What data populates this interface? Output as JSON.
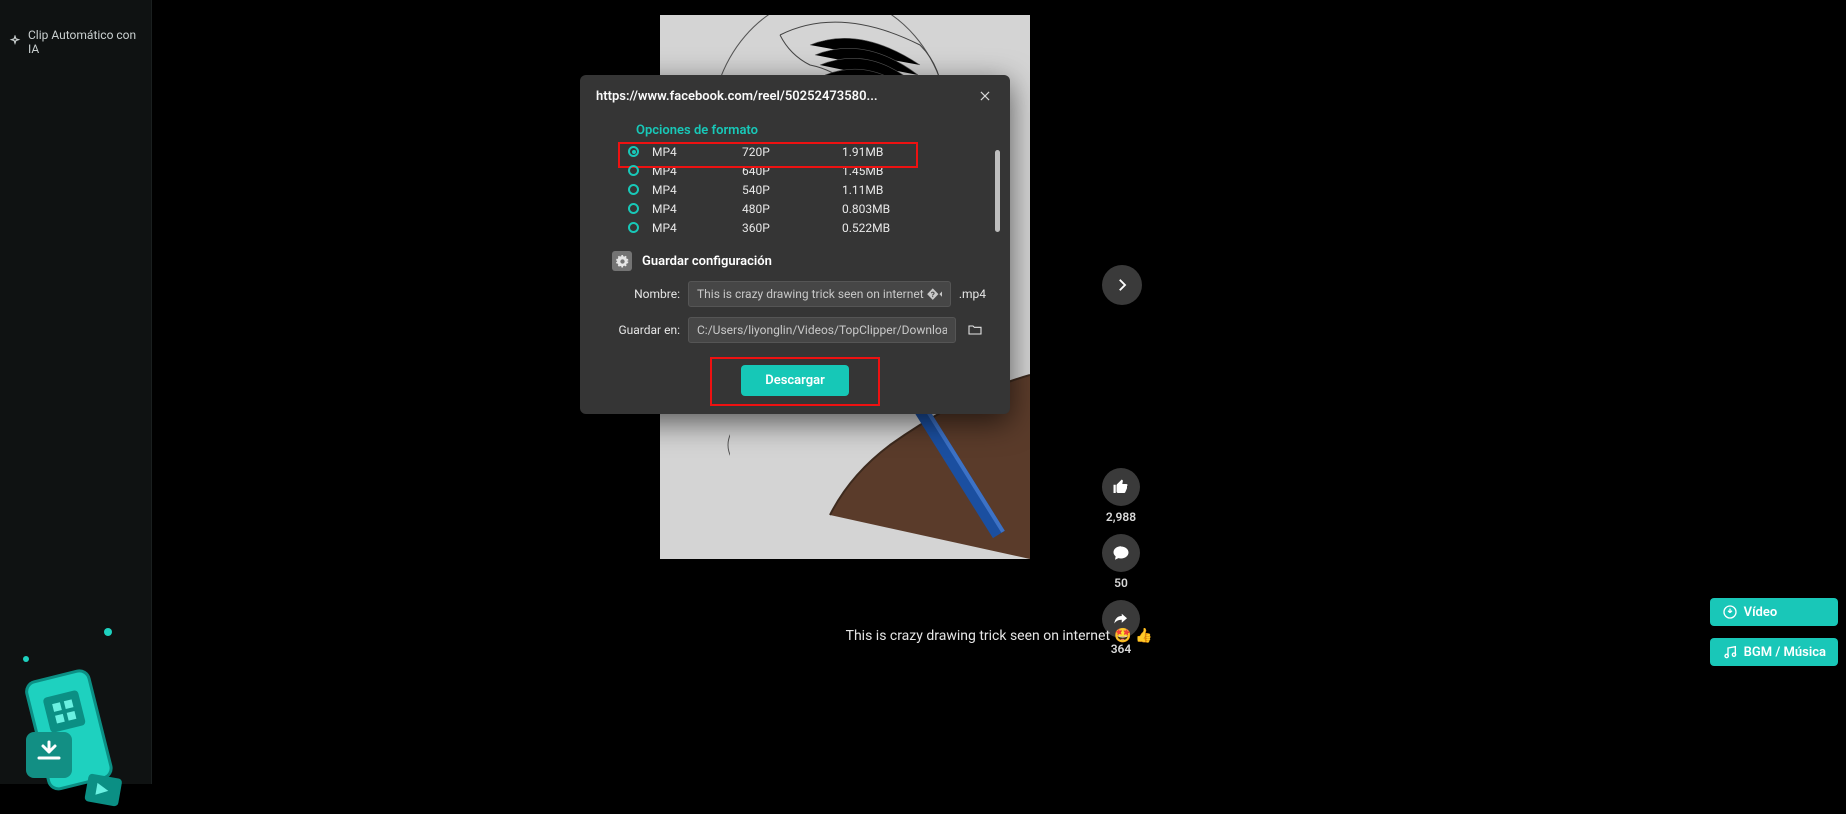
{
  "sidebar": {
    "ai_clip_label": "Clip Automático con IA"
  },
  "video": {
    "caption": "This is crazy drawing trick seen on internet",
    "caption_emoji": "🤩 👍"
  },
  "actions": {
    "likes": "2,988",
    "comments": "50",
    "shares": "364"
  },
  "float": {
    "video_label": "Vídeo",
    "bgm_label": "BGM / Música"
  },
  "dialog": {
    "url": "https://www.facebook.com/reel/50252473580...",
    "format_options_title": "Opciones de formato",
    "formats": [
      {
        "type": "MP4",
        "res": "720P",
        "size": "1.91MB",
        "selected": true
      },
      {
        "type": "MP4",
        "res": "640P",
        "size": "1.45MB",
        "selected": false
      },
      {
        "type": "MP4",
        "res": "540P",
        "size": "1.11MB",
        "selected": false
      },
      {
        "type": "MP4",
        "res": "480P",
        "size": "0.803MB",
        "selected": false
      },
      {
        "type": "MP4",
        "res": "360P",
        "size": "0.522MB",
        "selected": false
      }
    ],
    "save_config_title": "Guardar configuración",
    "name_label": "Nombre:",
    "name_value": "This is crazy drawing trick seen on internet ����✏",
    "name_ext": ".mp4",
    "save_in_label": "Guardar en:",
    "save_in_value": "C:/Users/liyonglin/Videos/TopClipper/Download",
    "download_label": "Descargar"
  }
}
